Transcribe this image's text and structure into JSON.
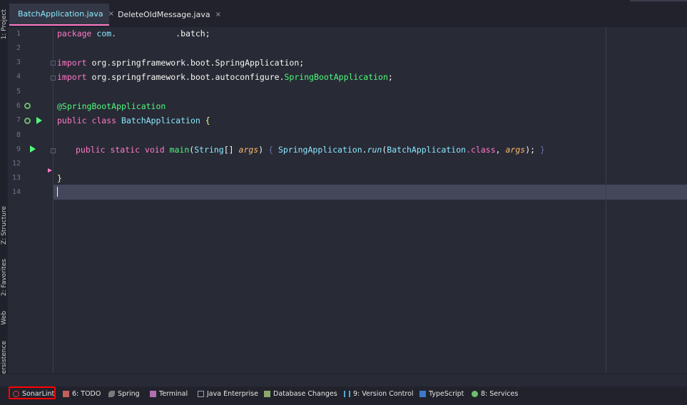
{
  "left_strip": {
    "project_tab": "1: Project",
    "structure_tab": "Z: Structure",
    "favorites_tab": "2: Favorites",
    "web_tab": "Web",
    "persistence_tab": "Persistence"
  },
  "tabs": [
    {
      "label": "BatchApplication.java",
      "active": true,
      "close": "×"
    },
    {
      "label": "DeleteOldMessage.java",
      "active": false,
      "close": "×"
    }
  ],
  "editor": {
    "line_numbers": [
      "1",
      "2",
      "3",
      "4",
      "5",
      "6",
      "7",
      "8",
      "9",
      "12",
      "13",
      "14"
    ],
    "lines": {
      "l1": {
        "kw": "package",
        "text": " com.",
        "text2": "            .batch;"
      },
      "l3": {
        "kw": "import",
        "text": " org.springframework.boot.SpringApplication;"
      },
      "l4": {
        "kw": "import",
        "text": " org.springframework.boot.autoconfigure.",
        "cls": "SpringBootApplication",
        ";": ";"
      },
      "l6": {
        "ann": "@SpringBootApplication"
      },
      "l7": {
        "kw": "public class",
        "cls": " BatchApplication",
        "brace": " {"
      },
      "l9": {
        "kw": "public static void",
        "fn": " main",
        "p1": "(",
        "cls1": "String",
        "p2": "[] ",
        "par": "args",
        "p3": ") ",
        "b1": "{ ",
        "cls2": "SpringApplication",
        "dot": ".",
        "fn2": "run",
        "p4": "(",
        "cls3": "BatchApplication",
        "cls_kw": ".class",
        ", ": ", ",
        "par2": "args",
        "p5": "); ",
        "b2": "}"
      },
      "l13": {
        "brace": "}"
      }
    }
  },
  "bottom_bar": [
    {
      "label": "SonarLint",
      "icon": "sonarlint-icon"
    },
    {
      "label": "6: TODO",
      "icon": "todo-icon"
    },
    {
      "label": "Spring",
      "icon": "spring-icon"
    },
    {
      "label": "Terminal",
      "icon": "terminal-icon"
    },
    {
      "label": "Java Enterprise",
      "icon": "java-enterprise-icon"
    },
    {
      "label": "Database Changes",
      "icon": "database-changes-icon"
    },
    {
      "label": "9: Version Control",
      "icon": "version-control-icon"
    },
    {
      "label": "TypeScript",
      "icon": "typescript-icon"
    },
    {
      "label": "8: Services",
      "icon": "services-icon"
    }
  ],
  "colors": {
    "keyword": "#ff79c6",
    "annotation": "#50fa7b",
    "class": "#8be9fd",
    "param": "#ffb86c",
    "highlight": "#ff0000"
  }
}
